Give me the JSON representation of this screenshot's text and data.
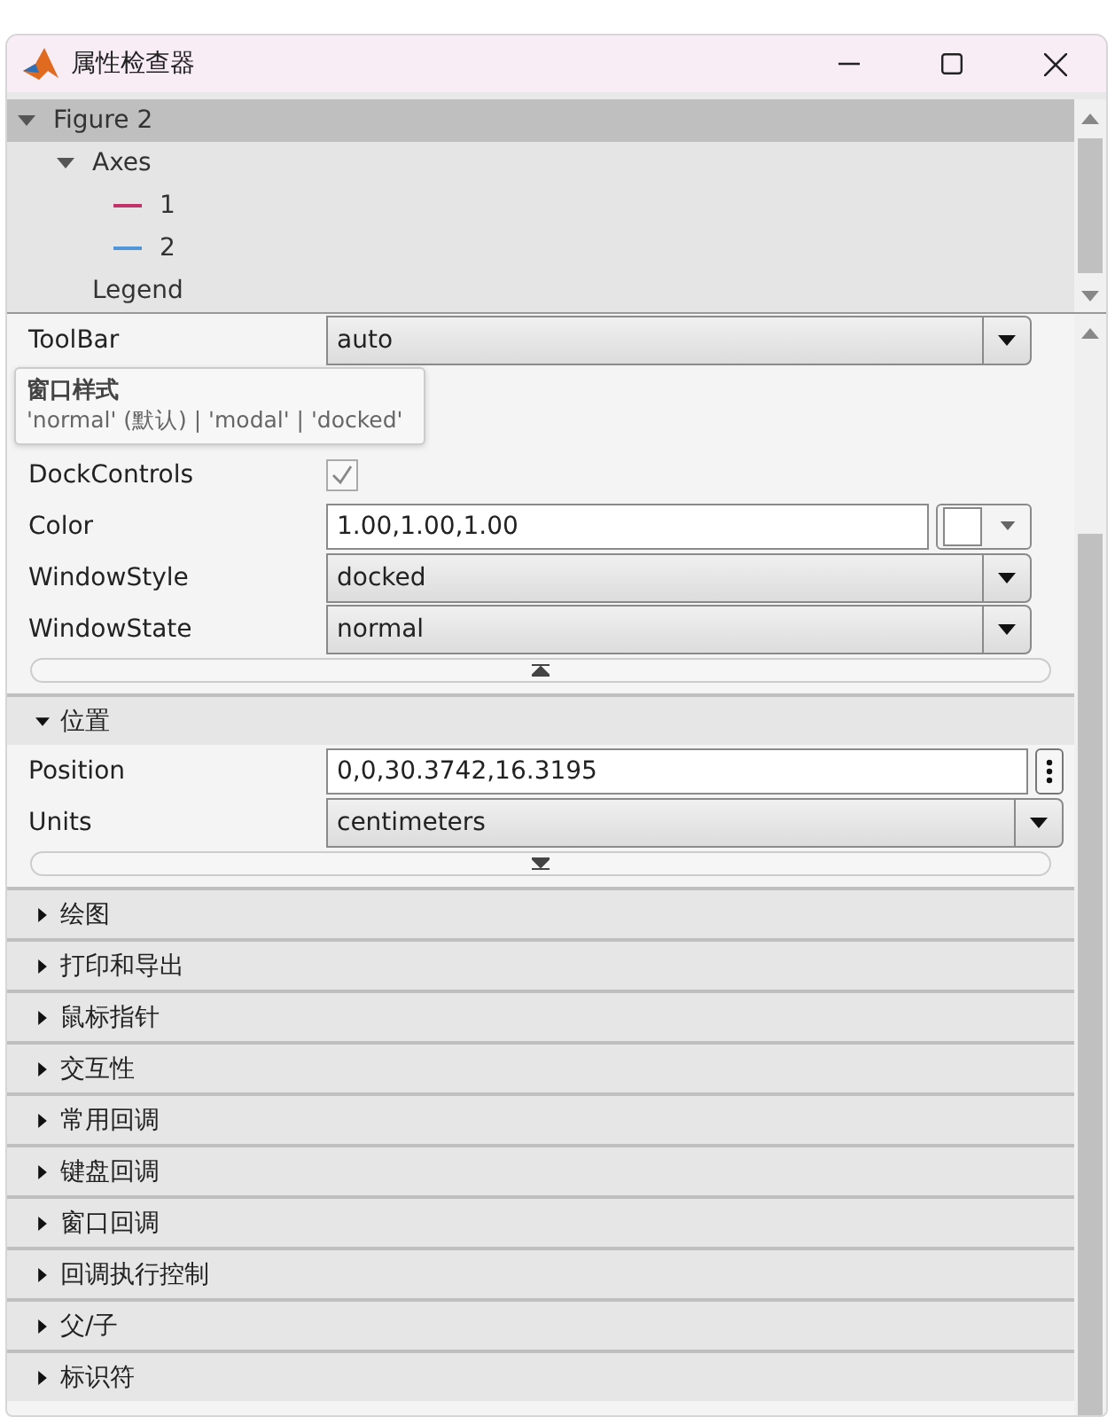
{
  "window": {
    "title": "属性检查器"
  },
  "tree": {
    "items": [
      {
        "label": "Figure 2",
        "selected": true,
        "expanded": true,
        "children": [
          {
            "label": "Axes",
            "selected": false,
            "expanded": true,
            "children": [
              {
                "label": "1",
                "color": "#c2336b",
                "selected": false
              },
              {
                "label": "2",
                "color": "#4f95d8",
                "selected": false
              }
            ]
          },
          {
            "label": "Legend",
            "selected": false
          }
        ]
      }
    ]
  },
  "properties": [
    {
      "kind": "dropdown",
      "name": "ToolBar",
      "value": "auto"
    },
    {
      "kind": "checkbox",
      "name": "DockControls",
      "checked": true
    },
    {
      "kind": "color",
      "name": "Color",
      "value": "1.00,1.00,1.00"
    },
    {
      "kind": "dropdown",
      "name": "WindowStyle",
      "value": "docked"
    },
    {
      "kind": "dropdown",
      "name": "WindowState",
      "value": "normal"
    }
  ],
  "tooltip": {
    "title": "窗口样式",
    "text": "'normal' (默认) | 'modal' | 'docked'"
  },
  "sections": [
    {
      "title": "位置",
      "expanded": true,
      "properties": [
        {
          "kind": "text",
          "name": "Position",
          "value": "0,0,30.3742,16.3195"
        },
        {
          "kind": "dropdown",
          "name": "Units",
          "value": "centimeters"
        }
      ]
    },
    {
      "title": "绘图",
      "expanded": false
    },
    {
      "title": "打印和导出",
      "expanded": false
    },
    {
      "title": "鼠标指针",
      "expanded": false
    },
    {
      "title": "交互性",
      "expanded": false
    },
    {
      "title": "常用回调",
      "expanded": false
    },
    {
      "title": "键盘回调",
      "expanded": false
    },
    {
      "title": "窗口回调",
      "expanded": false
    },
    {
      "title": "回调执行控制",
      "expanded": false
    },
    {
      "title": "父/子",
      "expanded": false
    },
    {
      "title": "标识符",
      "expanded": false
    }
  ]
}
